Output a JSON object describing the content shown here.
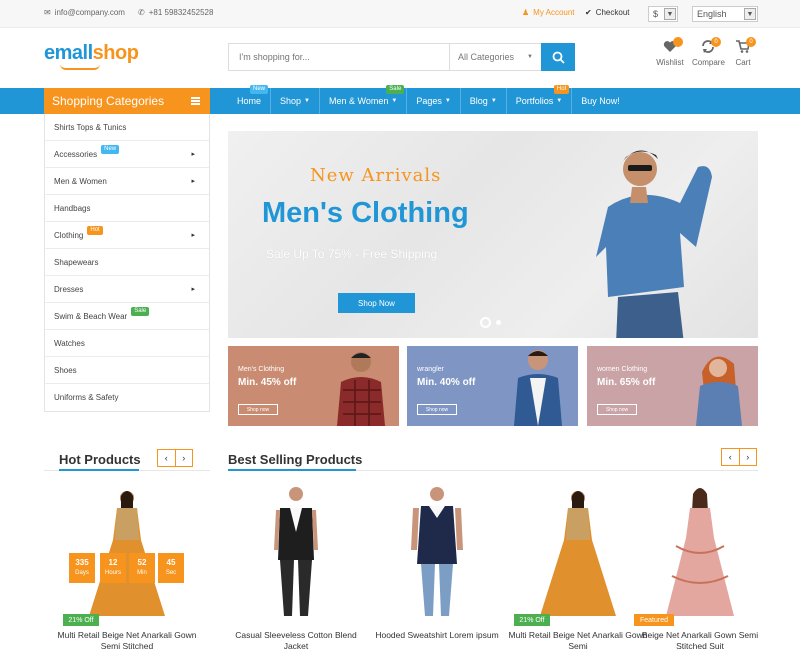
{
  "topbar": {
    "email": "info@company.com",
    "phone": "+81 59832452528",
    "my_account": "My Account",
    "checkout": "Checkout",
    "currency": "$",
    "language": "English"
  },
  "header": {
    "logo_part1": "emall",
    "logo_part2": "shop",
    "search_placeholder": "I'm shopping for...",
    "search_category": "All Categories",
    "wishlist": {
      "label": "Wishlist"
    },
    "compare": {
      "label": "Compare",
      "count": "0"
    },
    "cart": {
      "label": "Cart",
      "count": "0"
    }
  },
  "sidebar": {
    "title": "Shopping Categories",
    "items": [
      {
        "label": "Shirts Tops & Tunics",
        "arrow": "",
        "tag": ""
      },
      {
        "label": "Accessories",
        "arrow": "▸",
        "tag": "New"
      },
      {
        "label": "Men & Women",
        "arrow": "▸",
        "tag": ""
      },
      {
        "label": "Handbags",
        "arrow": "",
        "tag": ""
      },
      {
        "label": "Clothing",
        "arrow": "▸",
        "tag": "Hot"
      },
      {
        "label": "Shapewears",
        "arrow": "",
        "tag": ""
      },
      {
        "label": "Dresses",
        "arrow": "▸",
        "tag": ""
      },
      {
        "label": "Swim & Beach Wear",
        "arrow": "",
        "tag": "Sale"
      },
      {
        "label": "Watches",
        "arrow": "",
        "tag": ""
      },
      {
        "label": "Shoes",
        "arrow": "",
        "tag": ""
      },
      {
        "label": "Uniforms & Safety",
        "arrow": "",
        "tag": ""
      }
    ]
  },
  "nav": {
    "items": [
      {
        "label": "Home",
        "tag": "New",
        "dropdown": false
      },
      {
        "label": "Shop",
        "tag": "",
        "dropdown": true
      },
      {
        "label": "Men & Women",
        "tag": "Sale",
        "dropdown": true
      },
      {
        "label": "Pages",
        "tag": "",
        "dropdown": true
      },
      {
        "label": "Blog",
        "tag": "",
        "dropdown": true
      },
      {
        "label": "Portfolios",
        "tag": "Hot",
        "dropdown": true
      },
      {
        "label": "Buy Now!",
        "tag": "",
        "dropdown": false
      }
    ]
  },
  "hero": {
    "kicker": "New Arrivals",
    "title": "Men's Clothing",
    "subtitle": "Sale Up To 75% - Free Shipping",
    "cta": "Shop Now"
  },
  "promos": [
    {
      "tag": "Men's Clothing",
      "value": "Min. 45% off",
      "button": "Shop now",
      "color": "#c98b72"
    },
    {
      "tag": "wrangler",
      "value": "Min. 40% off",
      "button": "Shop now",
      "color": "#7f96c4"
    },
    {
      "tag": "women Clothing",
      "value": "Min. 65% off",
      "button": "Shop now",
      "color": "#c9a3a5"
    }
  ],
  "sections": {
    "hot": "Hot Products",
    "best": "Best Selling Products"
  },
  "countdown": [
    {
      "value": "335",
      "unit": "Days"
    },
    {
      "value": "12",
      "unit": "Hours"
    },
    {
      "value": "52",
      "unit": "Min"
    },
    {
      "value": "45",
      "unit": "Sec"
    }
  ],
  "products": [
    {
      "title": "Multi Retail Beige Net Anarkali Gown Semi Stitched",
      "label": "21% Off"
    },
    {
      "title": "Casual Sleeveless Cotton Blend Jacket",
      "label": ""
    },
    {
      "title": "Hooded Sweatshirt Lorem ipsum",
      "label": ""
    },
    {
      "title": "Multi Retail Beige Net Anarkali Gown Semi",
      "label": "21% Off"
    },
    {
      "title": "Beige Net Anarkali Gown Semi Stitched Suit",
      "label": "Featured"
    }
  ],
  "colors": {
    "primary": "#2196d6",
    "accent": "#f7941d",
    "sale": "#4caf50"
  }
}
